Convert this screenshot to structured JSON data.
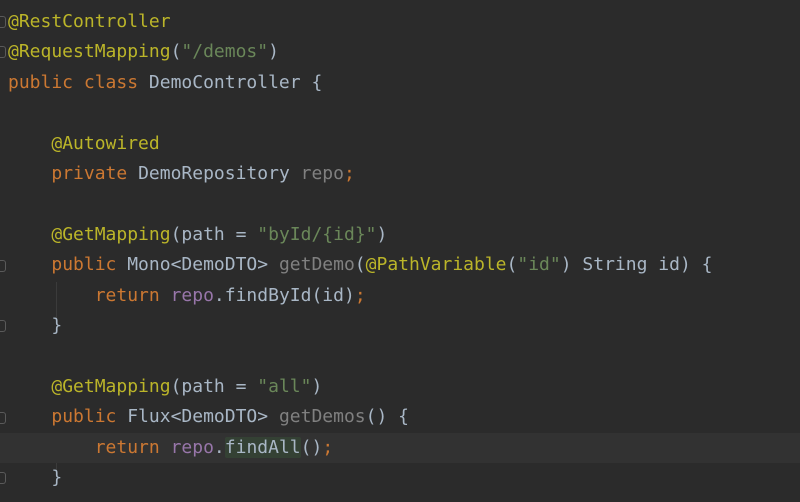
{
  "editor": {
    "lines": [
      {
        "tokens": [
          {
            "t": "@RestController",
            "c": "ann"
          }
        ]
      },
      {
        "tokens": [
          {
            "t": "@RequestMapping",
            "c": "ann"
          },
          {
            "t": "(",
            "c": "plain"
          },
          {
            "t": "\"/demos\"",
            "c": "str"
          },
          {
            "t": ")",
            "c": "plain"
          }
        ]
      },
      {
        "tokens": [
          {
            "t": "public class ",
            "c": "kw"
          },
          {
            "t": "DemoController {",
            "c": "plain"
          }
        ]
      },
      {
        "tokens": []
      },
      {
        "tokens": [
          {
            "t": "    ",
            "c": "plain"
          },
          {
            "t": "@Autowired",
            "c": "ann"
          }
        ]
      },
      {
        "tokens": [
          {
            "t": "    ",
            "c": "plain"
          },
          {
            "t": "private ",
            "c": "kw"
          },
          {
            "t": "DemoRepository ",
            "c": "plain"
          },
          {
            "t": "repo",
            "c": "unused"
          },
          {
            "t": ";",
            "c": "kw"
          }
        ]
      },
      {
        "tokens": []
      },
      {
        "tokens": [
          {
            "t": "    ",
            "c": "plain"
          },
          {
            "t": "@GetMapping",
            "c": "ann"
          },
          {
            "t": "(path = ",
            "c": "plain"
          },
          {
            "t": "\"byId/{id}\"",
            "c": "str"
          },
          {
            "t": ")",
            "c": "plain"
          }
        ]
      },
      {
        "tokens": [
          {
            "t": "    ",
            "c": "plain"
          },
          {
            "t": "public ",
            "c": "kw"
          },
          {
            "t": "Mono<DemoDTO> ",
            "c": "plain"
          },
          {
            "t": "getDemo",
            "c": "unused"
          },
          {
            "t": "(",
            "c": "plain"
          },
          {
            "t": "@PathVariable",
            "c": "ann"
          },
          {
            "t": "(",
            "c": "plain"
          },
          {
            "t": "\"id\"",
            "c": "str"
          },
          {
            "t": ") String id) {",
            "c": "plain"
          }
        ]
      },
      {
        "tokens": [
          {
            "t": "        ",
            "c": "plain"
          },
          {
            "t": "return ",
            "c": "kw"
          },
          {
            "t": "repo",
            "c": "fld"
          },
          {
            "t": ".findById(id)",
            "c": "plain"
          },
          {
            "t": ";",
            "c": "kw"
          }
        ]
      },
      {
        "tokens": [
          {
            "t": "    }",
            "c": "plain"
          }
        ]
      },
      {
        "tokens": []
      },
      {
        "tokens": [
          {
            "t": "    ",
            "c": "plain"
          },
          {
            "t": "@GetMapping",
            "c": "ann"
          },
          {
            "t": "(path = ",
            "c": "plain"
          },
          {
            "t": "\"all\"",
            "c": "str"
          },
          {
            "t": ")",
            "c": "plain"
          }
        ]
      },
      {
        "tokens": [
          {
            "t": "    ",
            "c": "plain"
          },
          {
            "t": "public ",
            "c": "kw"
          },
          {
            "t": "Flux<DemoDTO> ",
            "c": "plain"
          },
          {
            "t": "getDemos",
            "c": "unused"
          },
          {
            "t": "() {",
            "c": "plain"
          }
        ]
      },
      {
        "tokens": [
          {
            "t": "        ",
            "c": "plain"
          },
          {
            "t": "return ",
            "c": "kw"
          },
          {
            "t": "repo",
            "c": "fld"
          },
          {
            "t": ".",
            "c": "plain"
          },
          {
            "t": "findAll",
            "c": "plain hl"
          },
          {
            "t": "()",
            "c": "plain"
          },
          {
            "t": ";",
            "c": "kw"
          }
        ]
      },
      {
        "tokens": [
          {
            "t": "    }",
            "c": "plain"
          }
        ]
      }
    ]
  }
}
